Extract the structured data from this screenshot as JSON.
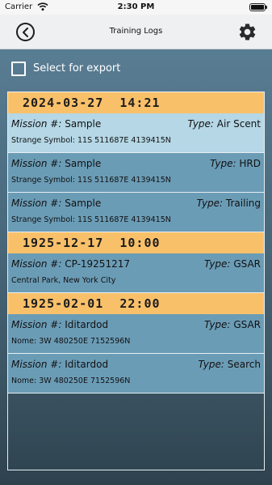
{
  "status_bar": {
    "carrier": "Carrier",
    "time": "2:30 PM"
  },
  "nav": {
    "title": "Training Logs",
    "back_icon": "chevron-left-circle-icon",
    "settings_icon": "gear-icon"
  },
  "export": {
    "label": "Select for export",
    "checked": false
  },
  "labels": {
    "mission": "Mission #:",
    "type": "Type:"
  },
  "colors": {
    "date_header": "#f9c06a",
    "entry_selected": "#b5d7e6",
    "entry": "#6b9cb6"
  },
  "groups": [
    {
      "date": "2024-03-27  14:21",
      "entries": [
        {
          "mission": "Sample",
          "type": "Air Scent",
          "location": "Strange Symbol: 11S 511687E  4139415N",
          "selected": true
        },
        {
          "mission": "Sample",
          "type": "HRD",
          "location": "Strange Symbol: 11S 511687E  4139415N",
          "selected": false
        },
        {
          "mission": "Sample",
          "type": "Trailing",
          "location": "Strange Symbol: 11S 511687E  4139415N",
          "selected": false
        }
      ]
    },
    {
      "date": "1925-12-17  10:00",
      "entries": [
        {
          "mission": "CP-19251217",
          "type": "GSAR",
          "location": "Central Park, New York City",
          "selected": false
        }
      ]
    },
    {
      "date": "1925-02-01  22:00",
      "entries": [
        {
          "mission": "Iditardod",
          "type": "GSAR",
          "location": "Nome: 3W 480250E  7152596N",
          "selected": false
        },
        {
          "mission": "Iditardod",
          "type": "Search",
          "location": "Nome: 3W 480250E  7152596N",
          "selected": false
        }
      ]
    }
  ]
}
